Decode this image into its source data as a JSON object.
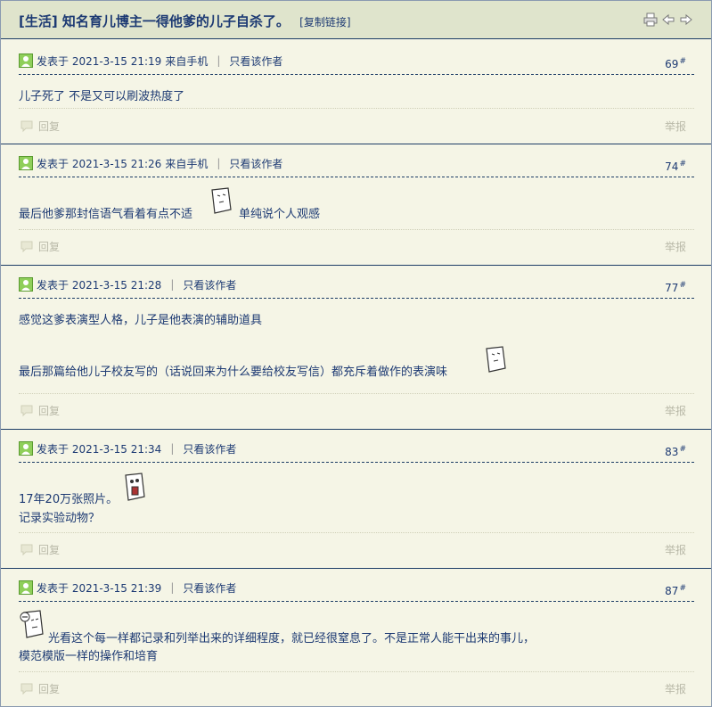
{
  "thread": {
    "title": "[生活] 知名育儿博主一得他爹的儿子自杀了。",
    "copy_link": "[复制链接]"
  },
  "icons": {
    "print": "print-icon",
    "prev": "arrow-left-icon",
    "next": "arrow-right-icon",
    "user": "user-icon",
    "reply": "reply-icon"
  },
  "colors": {
    "accent": "#1d3a73",
    "header_bg": "#dfe4cc",
    "page_bg": "#f5f5e6",
    "muted": "#b9b9a8"
  },
  "posts": [
    {
      "posted": "发表于 2021-3-15 21:19",
      "source": "来自手机",
      "only_author": "只看该作者",
      "floor": "69",
      "floor_mark": "#",
      "lines": [
        "儿子死了 不是又可以刷波热度了"
      ],
      "reply": "回复",
      "report": "举报"
    },
    {
      "posted": "发表于 2021-3-15 21:26",
      "source": "来自手机",
      "only_author": "只看该作者",
      "floor": "74",
      "floor_mark": "#",
      "lines": [
        "最后他爹那封信语气看着有点不适",
        "单纯说个人观感"
      ],
      "reply": "回复",
      "report": "举报"
    },
    {
      "posted": "发表于 2021-3-15 21:28",
      "only_author": "只看该作者",
      "floor": "77",
      "floor_mark": "#",
      "lines": [
        "感觉这爹表演型人格，儿子是他表演的辅助道具",
        "最后那篇给他儿子校友写的（话说回来为什么要给校友写信）都充斥着做作的表演味"
      ],
      "reply": "回复",
      "report": "举报"
    },
    {
      "posted": "发表于 2021-3-15 21:34",
      "only_author": "只看该作者",
      "floor": "83",
      "floor_mark": "#",
      "lines": [
        "17年20万张照片。",
        "记录实验动物？"
      ],
      "reply": "回复",
      "report": "举报"
    },
    {
      "posted": "发表于 2021-3-15 21:39",
      "only_author": "只看该作者",
      "floor": "87",
      "floor_mark": "#",
      "lines": [
        "光看这个每一样都记录和列举出来的详细程度，就已经很窒息了。不是正常人能干出来的事儿，",
        "模范模版一样的操作和培育"
      ],
      "reply": "回复",
      "report": "举报"
    }
  ]
}
